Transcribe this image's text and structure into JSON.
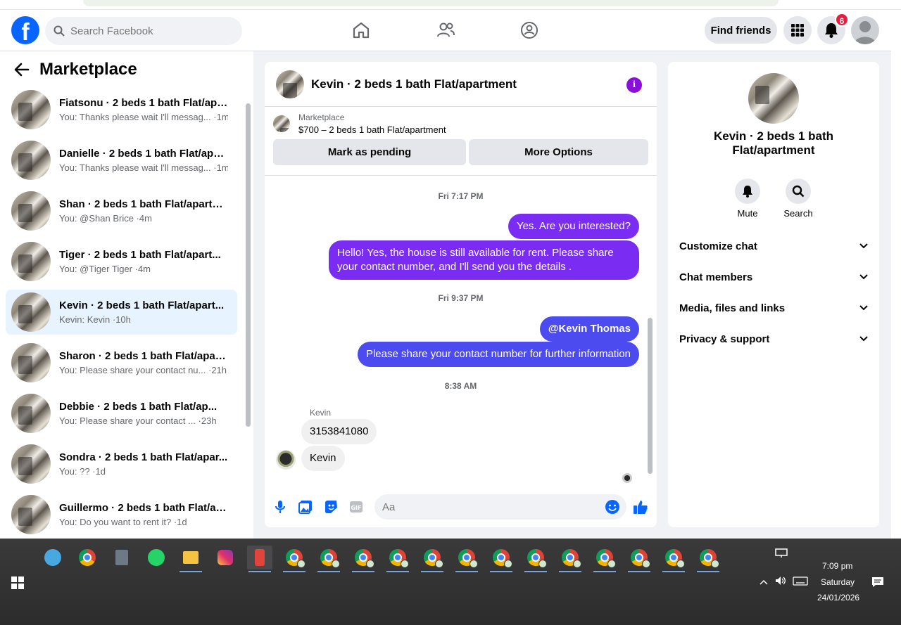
{
  "browser": {},
  "topnav": {
    "search_placeholder": "Search Facebook",
    "find_friends": "Find friends",
    "notification_count": "6"
  },
  "sidebar": {
    "title": "Marketplace",
    "conversations": [
      {
        "title": "Fiatsonu · 2 beds 1 bath Flat/apa...",
        "sub": "You: Thanks please wait I'll messag... ·1m",
        "active": false
      },
      {
        "title": "Danielle · 2 beds 1 bath Flat/apa...",
        "sub": "You: Thanks please wait I'll messag... ·1m",
        "active": false
      },
      {
        "title": "Shan · 2 beds 1 bath Flat/apartm...",
        "sub": "You: @Shan Brice ·4m",
        "active": false
      },
      {
        "title": "Tiger · 2 beds 1 bath Flat/apart...",
        "sub": "You: @Tiger Tiger ·4m",
        "active": false
      },
      {
        "title": "Kevin · 2 beds 1 bath Flat/apart...",
        "sub": "Kevin: Kevin ·10h",
        "active": true
      },
      {
        "title": "Sharon · 2 beds 1 bath Flat/apart...",
        "sub": "You: Please share your contact nu... ·21h",
        "active": false
      },
      {
        "title": "Debbie · 2 beds 1 bath Flat/ap...",
        "sub": "You: Please share your contact ... ·23h",
        "active": false
      },
      {
        "title": "Sondra · 2 beds 1 bath Flat/apar...",
        "sub": "You: ?? ·1d",
        "active": false
      },
      {
        "title": "Guillermo · 2 beds 1 bath Flat/ap...",
        "sub": "You: Do you want to rent it? ·1d",
        "active": false
      }
    ]
  },
  "chat": {
    "title": "Kevin · 2 beds 1 bath Flat/apartment",
    "marketplace_label": "Marketplace",
    "listing": "$700 – 2 beds 1 bath Flat/apartment",
    "mark_pending": "Mark as pending",
    "more_options": "More Options",
    "ts1": "Fri 7:17 PM",
    "msg1": "Yes. Are you interested?",
    "msg2": "Hello! Yes, the house is still available for rent. Please share your contact number, and I'll send you the details .",
    "ts2": "Fri 9:37 PM",
    "msg3": "@Kevin Thomas",
    "msg4": "Please share your contact number for further information",
    "ts3": "8:38 AM",
    "sender": "Kevin",
    "msg5": "3153841080",
    "msg6": "Kevin",
    "input_placeholder": "Aa"
  },
  "rpanel": {
    "title": "Kevin · 2 beds 1 bath Flat/apartment",
    "mute": "Mute",
    "search": "Search",
    "rows": [
      "Customize chat",
      "Chat members",
      "Media, files and links",
      "Privacy & support"
    ]
  },
  "taskbar": {
    "time": "7:09 pm",
    "day": "Saturday",
    "date": "24/01/2026"
  },
  "colors": {
    "accent": "#0866ff",
    "bubble_purple": "#7b2cf3",
    "bubble_blue": "#4b4bf0",
    "active_row": "#e7f3ff"
  }
}
